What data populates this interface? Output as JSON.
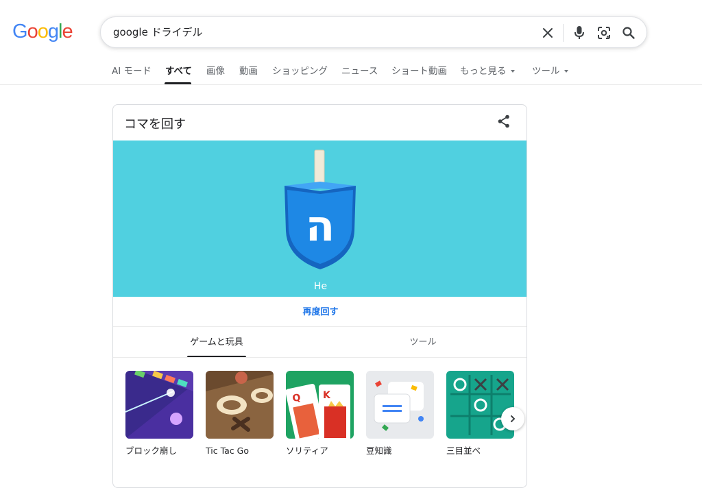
{
  "logo": {
    "letters": [
      "G",
      "o",
      "o",
      "g",
      "l",
      "e"
    ],
    "colors": [
      "#4285F4",
      "#EA4335",
      "#FBBC05",
      "#4285F4",
      "#34A853",
      "#EA4335"
    ]
  },
  "search": {
    "query": "google ドライデル"
  },
  "tabs": [
    {
      "label": "AI モード"
    },
    {
      "label": "すべて",
      "active": true
    },
    {
      "label": "画像"
    },
    {
      "label": "動画"
    },
    {
      "label": "ショッピング"
    },
    {
      "label": "ニュース"
    },
    {
      "label": "ショート動画"
    },
    {
      "label": "もっと見る"
    },
    {
      "label": "ツール"
    }
  ],
  "card": {
    "title": "コマを回す",
    "dreidel_letter": "ה",
    "dreidel_result": "He",
    "spin_again": "再度回す",
    "subtabs": [
      "ゲームと玩具",
      "ツール"
    ],
    "games": [
      {
        "label": "ブロック崩し"
      },
      {
        "label": "Tic Tac Go"
      },
      {
        "label": "ソリティア"
      },
      {
        "label": "豆知識"
      },
      {
        "label": "三目並べ"
      }
    ]
  },
  "colors": {
    "play_area": "#50D0E0",
    "dreidel_blue": "#1E88E5",
    "link_blue": "#1A73E8"
  }
}
